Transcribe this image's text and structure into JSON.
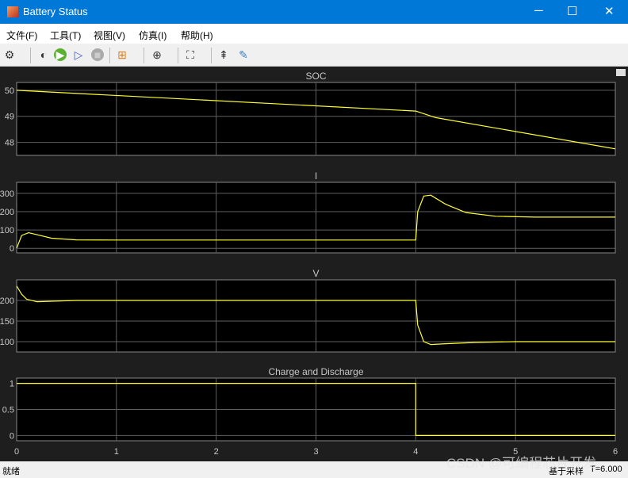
{
  "window": {
    "title": "Battery Status",
    "minimize": "─",
    "maximize": "☐",
    "close": "✕"
  },
  "menu": [
    "文件(F)",
    "工具(T)",
    "视图(V)",
    "仿真(I)",
    "帮助(H)"
  ],
  "toolbar": [
    "gear-icon",
    "highlight-block-icon",
    "run-icon",
    "step-forward-icon",
    "stop-icon",
    "layout-icon",
    "zoom-icon",
    "autoscale-icon",
    "triggers-icon",
    "cursor-measurements-icon"
  ],
  "status": {
    "left": "就绪",
    "sampling": "基于采样",
    "time": "T=6.000"
  },
  "watermark": "CSDN @可编程芯片开发",
  "colors": {
    "trace": "#ffff33",
    "axes_bg": "#000000",
    "grid": "#606060",
    "text": "#c8c8c8"
  },
  "chart_data": [
    {
      "type": "line",
      "title": "SOC",
      "xlim": [
        0,
        6
      ],
      "ylim": [
        47.5,
        50.3
      ],
      "yticks": [
        48,
        49,
        50
      ],
      "x": [
        0,
        4,
        4.2,
        6
      ],
      "y": [
        50,
        49.2,
        48.95,
        47.75
      ]
    },
    {
      "type": "line",
      "title": "I",
      "xlim": [
        0,
        6
      ],
      "ylim": [
        -25,
        360
      ],
      "yticks": [
        0,
        100,
        200,
        300
      ],
      "x": [
        0,
        0.05,
        0.12,
        0.2,
        0.35,
        0.6,
        1,
        4,
        4.02,
        4.08,
        4.15,
        4.3,
        4.5,
        4.8,
        5.2,
        6
      ],
      "y": [
        0,
        70,
        85,
        75,
        55,
        46,
        45,
        45,
        200,
        285,
        290,
        240,
        195,
        175,
        170,
        170
      ]
    },
    {
      "type": "line",
      "title": "V",
      "xlim": [
        0,
        6
      ],
      "ylim": [
        75,
        250
      ],
      "yticks": [
        100,
        150,
        200
      ],
      "x": [
        0,
        0.05,
        0.1,
        0.2,
        0.35,
        0.6,
        1,
        4,
        4.02,
        4.08,
        4.15,
        4.3,
        4.6,
        5,
        6
      ],
      "y": [
        235,
        215,
        203,
        197,
        198,
        200,
        200,
        200,
        140,
        100,
        93,
        95,
        98,
        100,
        100
      ]
    },
    {
      "type": "line",
      "title": "Charge and Discharge",
      "xlim": [
        0,
        6
      ],
      "ylim": [
        -0.1,
        1.1
      ],
      "yticks": [
        0,
        0.5,
        1
      ],
      "x": [
        0,
        4,
        4,
        6
      ],
      "y": [
        1,
        1,
        0,
        0
      ],
      "xticks": [
        0,
        1,
        2,
        3,
        4,
        5,
        6
      ]
    }
  ]
}
